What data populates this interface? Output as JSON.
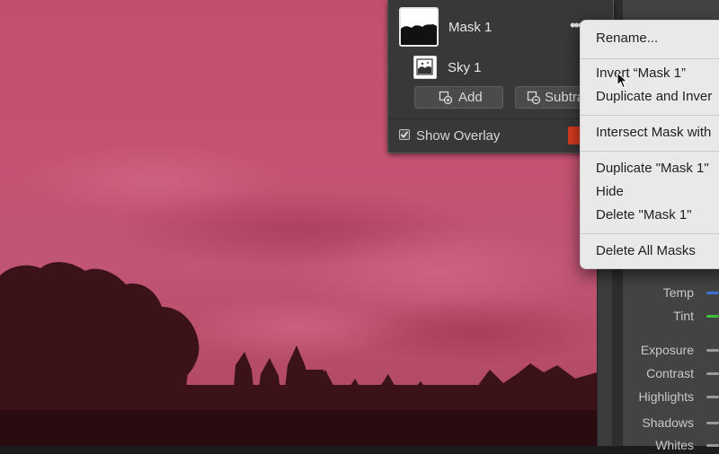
{
  "masks_panel": {
    "mask_name": "Mask 1",
    "more_icon": "more-dots-icon",
    "component_name": "Sky 1",
    "add_label": "Add",
    "subtract_label": "Subtra",
    "show_overlay_label": "Show Overlay",
    "show_overlay_checked": true,
    "overlay_color": "#d63a1e"
  },
  "context_menu": {
    "items": [
      "Rename...",
      "Invert “Mask 1”",
      "Duplicate and Inver",
      "Intersect Mask with",
      "Duplicate \"Mask 1\"",
      "Hide",
      "Delete \"Mask 1\"",
      "Delete All Masks"
    ]
  },
  "right_panel": {
    "sliders": [
      {
        "label": "Temp",
        "color": "#3f6fd8"
      },
      {
        "label": "Tint",
        "color": "#3fbf3a"
      },
      {
        "label": "Exposure",
        "color": "#9a9a9a"
      },
      {
        "label": "Contrast",
        "color": "#9a9a9a"
      },
      {
        "label": "Highlights",
        "color": "#9a9a9a"
      },
      {
        "label": "Shadows",
        "color": "#9a9a9a"
      },
      {
        "label": "Whites",
        "color": "#9a9a9a"
      }
    ]
  },
  "colors": {
    "mask_overlay": "#c24f6e",
    "panel_bg": "#383838",
    "menu_bg": "#e9e9e9"
  }
}
